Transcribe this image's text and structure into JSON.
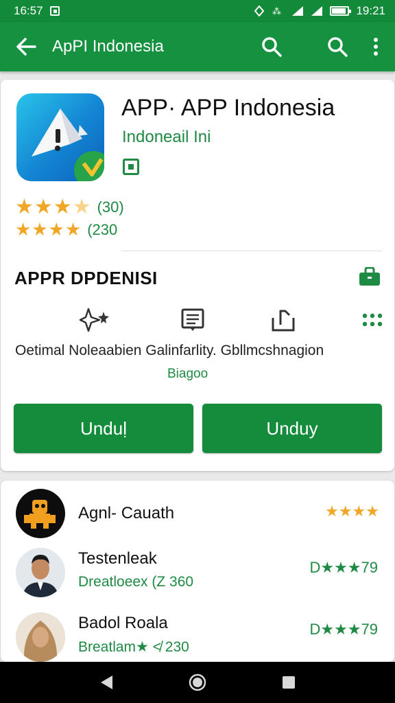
{
  "status_bar": {
    "time_left": "16:57",
    "time_right": "19:21"
  },
  "app_bar": {
    "title": "ApPI Indonesia",
    "icons": [
      "back-arrow-icon",
      "search-icon",
      "search-icon",
      "more-vert-icon"
    ]
  },
  "app": {
    "name": "APP·  APP Indonesia",
    "developer": "Indoneail Ini",
    "rating_primary": "(30)",
    "rating_secondary": "(230"
  },
  "section": {
    "title": "APPR DPDENISI"
  },
  "features": {
    "labels_line": "Oetimal Noleaabien Galinfarlity. Gbllmcshnagion",
    "sub_label": "Biagoo"
  },
  "buttons": {
    "primary": "Unduḷ",
    "secondary": "Unduy"
  },
  "reviews": [
    {
      "name": "Agnl- Cauath",
      "sub": "",
      "score": "★★★★"
    },
    {
      "name": "Testenleak",
      "sub": "Dreatloeex (Z 360",
      "score": "D★★★79"
    },
    {
      "name": "Badol Roala",
      "sub": "Breatlam★ ≮ 230",
      "score": "D★★★79"
    }
  ],
  "colors": {
    "primary": "#159140",
    "accent_text": "#1e8a43",
    "star": "#f2a625"
  }
}
